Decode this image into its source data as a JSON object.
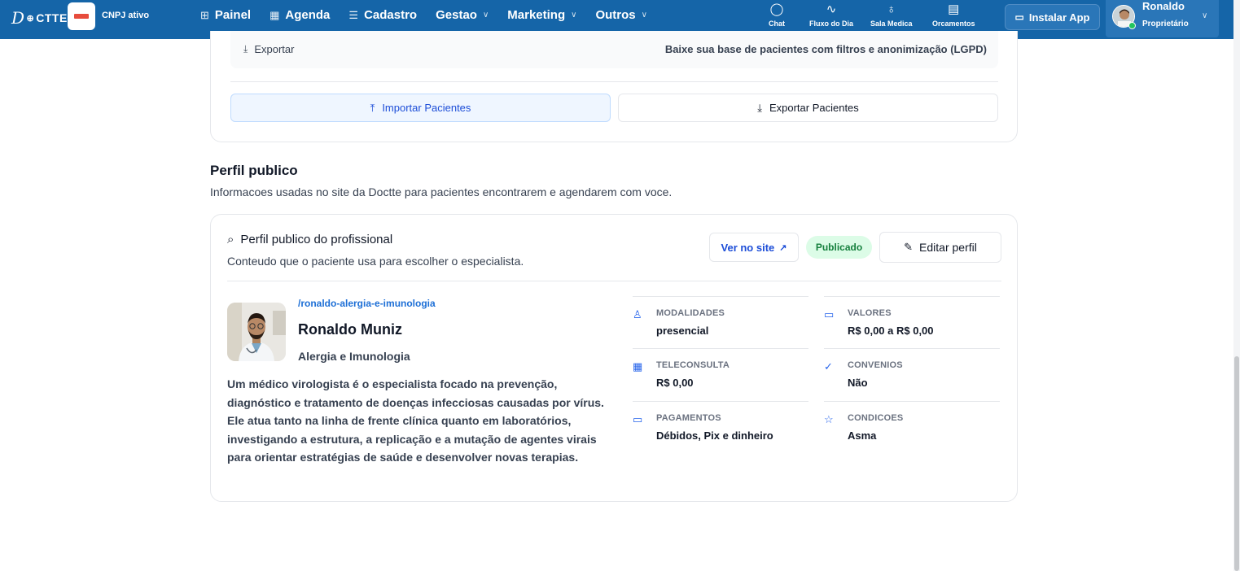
{
  "topbar": {
    "logo_d": "D",
    "logo_text": "CTTE",
    "cnpj_status": "CNPJ ativo",
    "nav": [
      {
        "label": "Painel",
        "icon": "grid-icon",
        "has_chevron": false
      },
      {
        "label": "Agenda",
        "icon": "calendar-icon",
        "has_chevron": false
      },
      {
        "label": "Cadastro",
        "icon": "database-icon",
        "has_chevron": false
      },
      {
        "label": "Gestao",
        "icon": "",
        "has_chevron": true
      },
      {
        "label": "Marketing",
        "icon": "",
        "has_chevron": true
      },
      {
        "label": "Outros",
        "icon": "",
        "has_chevron": true
      }
    ],
    "quick": [
      {
        "label": "Chat",
        "icon": "chat-icon"
      },
      {
        "label": "Fluxo do Dia",
        "icon": "activity-icon"
      },
      {
        "label": "Sala Medica",
        "icon": "stethoscope-icon"
      },
      {
        "label": "Orcamentos",
        "icon": "document-icon"
      }
    ],
    "install_label": "Instalar App",
    "user": {
      "name": "Ronaldo",
      "role": "Proprietário"
    }
  },
  "export_section": {
    "row_label": "Exportar",
    "row_desc": "Baixe sua base de pacientes com filtros e anonimização (LGPD)",
    "import_button": "Importar Pacientes",
    "export_button": "Exportar Pacientes"
  },
  "public_profile": {
    "title": "Perfil publico",
    "subtitle": "Informacoes usadas no site da Doctte para pacientes encontrarem e agendarem com voce.",
    "card_title": "Perfil publico do profissional",
    "card_subtitle": "Conteudo que o paciente usa para escolher o especialista.",
    "view_site_label": "Ver no site",
    "status_badge": "Publicado",
    "edit_label": "Editar perfil",
    "slug": "/ronaldo-alergia-e-imunologia",
    "name": "Ronaldo Muniz",
    "specialty": "Alergia e Imunologia",
    "bio": "Um médico virologista é o especialista focado na prevenção, diagnóstico e tratamento de doenças infecciosas causadas por vírus. Ele atua tanto na linha de frente clínica quanto em laboratórios, investigando a estrutura, a replicação e a mutação de agentes virais para orientar estratégias de saúde e desenvolver novas terapias.",
    "facts": [
      {
        "label": "MODALIDADES",
        "value": "presencial",
        "icon": "user-icon"
      },
      {
        "label": "VALORES",
        "value": "R$ 0,00 a R$ 0,00",
        "icon": "card-icon"
      },
      {
        "label": "TELECONSULTA",
        "value": "R$ 0,00",
        "icon": "calendar-check-icon"
      },
      {
        "label": "CONVENIOS",
        "value": "Não",
        "icon": "check-circle-icon"
      },
      {
        "label": "PAGAMENTOS",
        "value": "Débidos, Pix e dinheiro",
        "icon": "card-icon"
      },
      {
        "label": "CONDICOES",
        "value": "Asma",
        "icon": "star-icon"
      }
    ]
  }
}
